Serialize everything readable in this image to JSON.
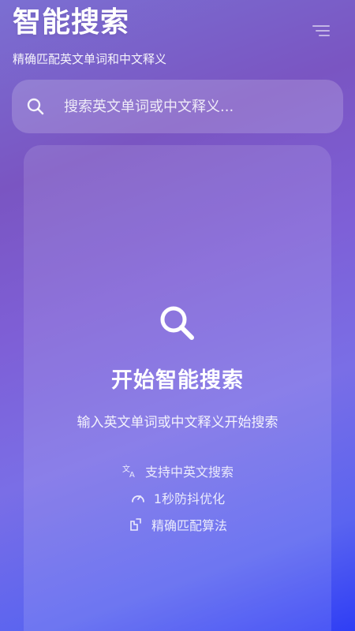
{
  "header": {
    "title": "智能搜索",
    "subtitle": "精确匹配英文单词和中文释义",
    "menu_icon": "menu-icon"
  },
  "search": {
    "placeholder": "搜索英文单词或中文释义...",
    "icon": "search-icon"
  },
  "empty_state": {
    "icon": "search-icon",
    "title": "开始智能搜索",
    "description": "输入英文单词或中文释义开始搜索",
    "features": [
      {
        "icon": "translate-icon",
        "label": "支持中英文搜索"
      },
      {
        "icon": "speedometer-icon",
        "label": "1秒防抖优化"
      },
      {
        "icon": "target-icon",
        "label": "精确匹配算法"
      }
    ]
  },
  "colors": {
    "text": "#ffffff",
    "gradient_start": "#7b6fd2",
    "gradient_end": "#2f3ef5"
  }
}
